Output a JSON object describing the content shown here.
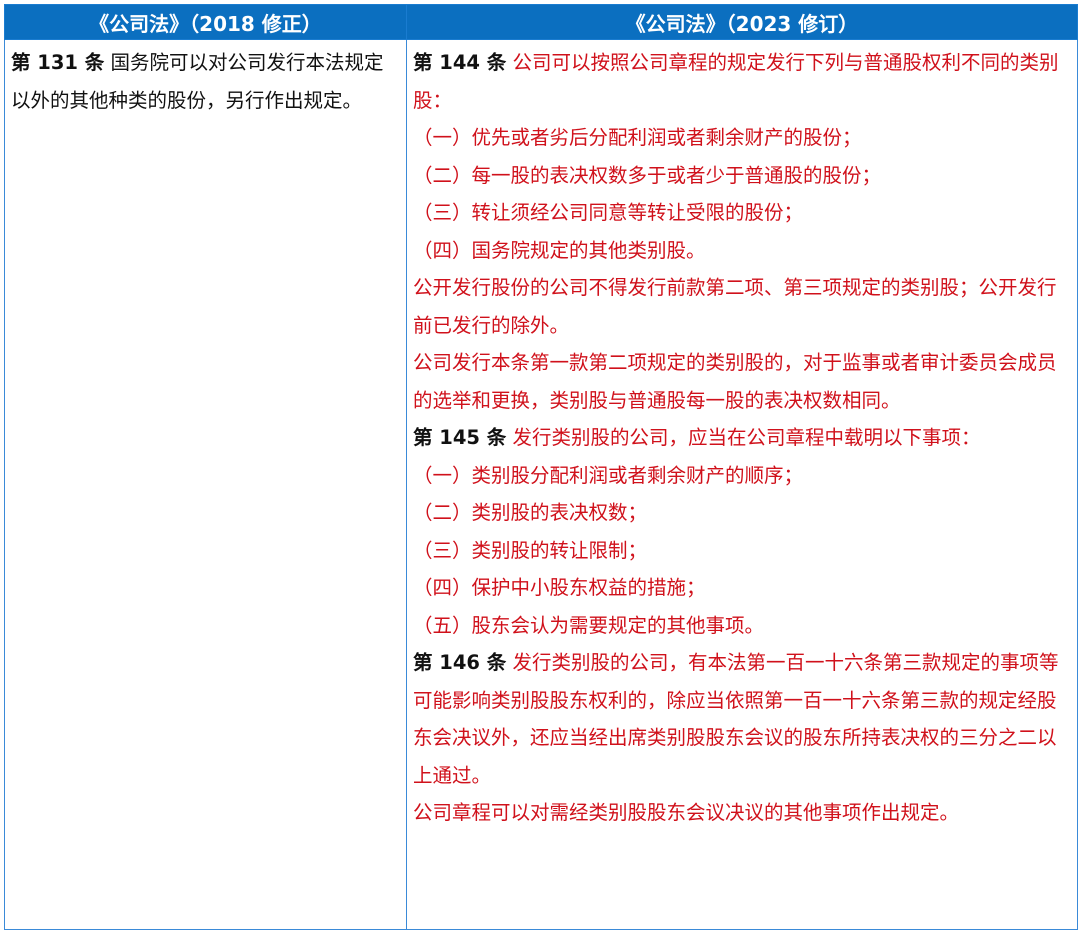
{
  "headers": [
    "《公司法》（2018 修正）",
    "《公司法》（2023 修订）"
  ],
  "left": {
    "article": "第 131 条",
    "text": " 国务院可以对公司发行本法规定以外的其他种类的股份，另行作出规定。"
  },
  "right": {
    "a144": {
      "article": "第 144 条",
      "intro": " 公司可以按照公司章程的规定发行下列与普通股权利不同的类别股：",
      "items": [
        "（一）优先或者劣后分配利润或者剩余财产的股份；",
        "（二）每一股的表决权数多于或者少于普通股的股份；",
        "（三）转让须经公司同意等转让受限的股份；",
        "（四）国务院规定的其他类别股。"
      ],
      "p2": "公开发行股份的公司不得发行前款第二项、第三项规定的类别股；公开发行前已发行的除外。",
      "p3": "公司发行本条第一款第二项规定的类别股的，对于监事或者审计委员会成员的选举和更换，类别股与普通股每一股的表决权数相同。"
    },
    "a145": {
      "article": "第 145 条",
      "intro": " 发行类别股的公司，应当在公司章程中载明以下事项：",
      "items": [
        "（一）类别股分配利润或者剩余财产的顺序；",
        "（二）类别股的表决权数；",
        "（三）类别股的转让限制；",
        "（四）保护中小股东权益的措施；",
        "（五）股东会认为需要规定的其他事项。"
      ]
    },
    "a146": {
      "article": "第 146 条",
      "intro": " 发行类别股的公司，有本法第一百一十六条第三款规定的事项等可能影响类别股股东权利的，除应当依照第一百一十六条第三款的规定经股东会决议外，还应当经出席类别股股东会议的股东所持表决权的三分之二以上通过。",
      "p2": "公司章程可以对需经类别股股东会议决议的其他事项作出规定。"
    }
  },
  "colors": {
    "header_bg": "#0b6fc0",
    "header_text": "#ffffff",
    "amended_text": "#d0111b",
    "border": "#3a8ad8"
  }
}
